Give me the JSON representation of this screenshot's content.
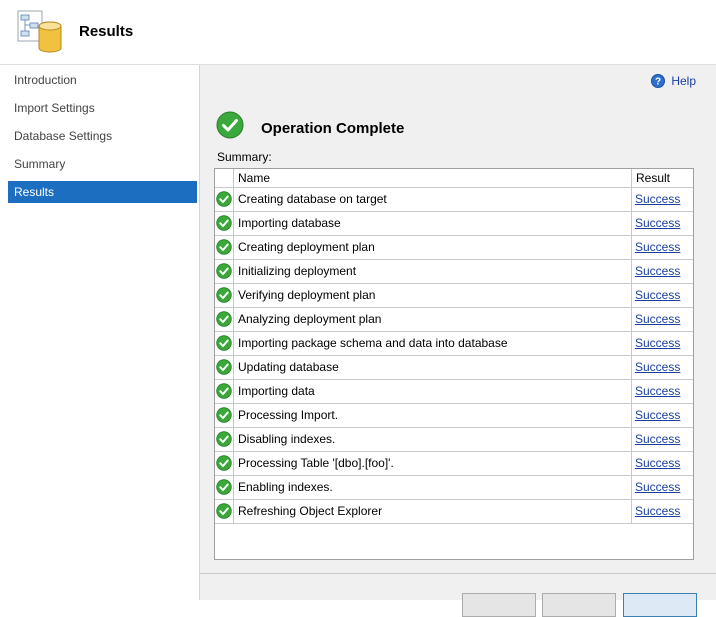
{
  "header": {
    "title": "Results"
  },
  "sidebar": {
    "items": [
      {
        "label": "Introduction",
        "active": false
      },
      {
        "label": "Import Settings",
        "active": false
      },
      {
        "label": "Database Settings",
        "active": false
      },
      {
        "label": "Summary",
        "active": false
      },
      {
        "label": "Results",
        "active": true
      }
    ]
  },
  "main": {
    "help_label": "Help",
    "status_title": "Operation Complete",
    "summary_label": "Summary:",
    "columns": {
      "name": "Name",
      "result": "Result"
    },
    "rows": [
      {
        "name": "Creating database on target",
        "result": "Success"
      },
      {
        "name": "Importing database",
        "result": "Success"
      },
      {
        "name": "Creating deployment plan",
        "result": "Success"
      },
      {
        "name": "Initializing deployment",
        "result": "Success"
      },
      {
        "name": "Verifying deployment plan",
        "result": "Success"
      },
      {
        "name": "Analyzing deployment plan",
        "result": "Success"
      },
      {
        "name": "Importing package schema and data into database",
        "result": "Success"
      },
      {
        "name": "Updating database",
        "result": "Success"
      },
      {
        "name": "Importing data",
        "result": "Success"
      },
      {
        "name": "Processing Import.",
        "result": "Success"
      },
      {
        "name": "Disabling indexes.",
        "result": "Success"
      },
      {
        "name": "Processing Table '[dbo].[foo]'.",
        "result": "Success"
      },
      {
        "name": "Enabling indexes.",
        "result": "Success"
      },
      {
        "name": "Refreshing Object Explorer",
        "result": "Success"
      }
    ]
  },
  "footer": {
    "previous_label": "",
    "next_label": "",
    "close_label": ""
  },
  "colors": {
    "accent": "#1c6ec1",
    "link": "#1a3fa3",
    "success": "#3aa83a"
  }
}
